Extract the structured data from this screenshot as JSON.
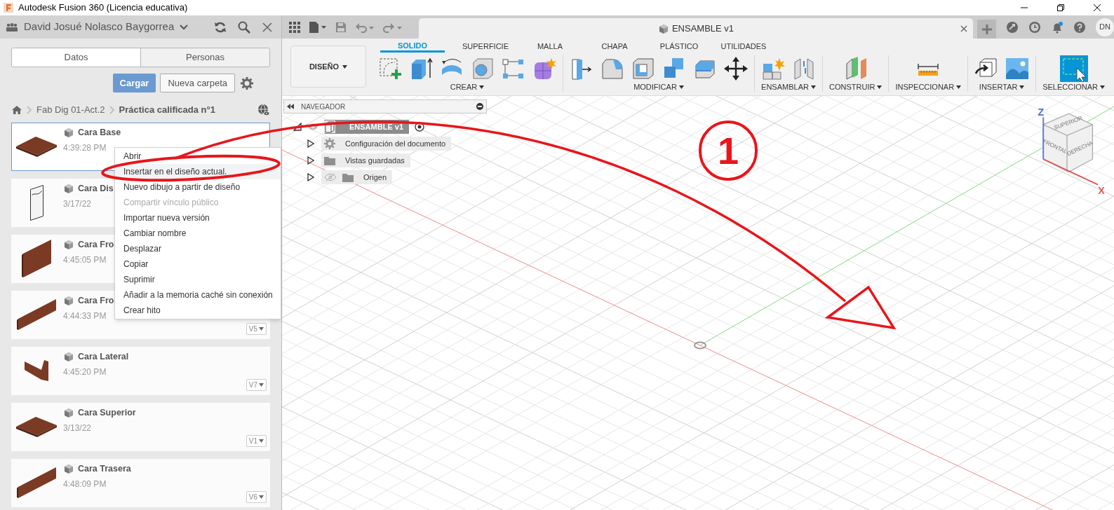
{
  "window": {
    "title": "Autodesk Fusion 360 (Licencia educativa)"
  },
  "data_panel": {
    "user": "David Josué Nolasco Baygorrea",
    "tabs": [
      {
        "label": "Datos",
        "selected": true
      },
      {
        "label": "Personas",
        "selected": false
      }
    ],
    "upload_button": "Cargar",
    "new_folder_button": "Nueva carpeta",
    "breadcrumb": [
      "Fab Dig 01-Act.2",
      "Práctica calificada n°1"
    ],
    "files": [
      {
        "name": "Cara Base",
        "date": "4:39:28 PM",
        "selected": true,
        "kind": "plate"
      },
      {
        "name": "Cara Dis",
        "date": "3/17/22",
        "selected": false,
        "kind": "sheet"
      },
      {
        "name": "Cara Fro",
        "date": "4:45:05 PM",
        "selected": false,
        "kind": "board"
      },
      {
        "name": "Cara Fro",
        "date": "4:44:33 PM",
        "version": "V5",
        "selected": false,
        "kind": "long_board"
      },
      {
        "name": "Cara Lateral",
        "date": "4:45:20 PM",
        "version": "V7",
        "selected": false,
        "kind": "side"
      },
      {
        "name": "Cara Superior",
        "date": "3/13/22",
        "version": "V1",
        "selected": false,
        "kind": "plate"
      },
      {
        "name": "Cara Trasera",
        "date": "4:48:09 PM",
        "version": "V6",
        "selected": false,
        "kind": "long_board"
      }
    ]
  },
  "context_menu": [
    {
      "label": "Abrir",
      "disabled": false,
      "highlighted": false
    },
    {
      "label": "Insertar en el diseño actual.",
      "disabled": false,
      "highlighted": true
    },
    {
      "label": "Nuevo dibujo a partir de diseño",
      "disabled": false,
      "highlighted": false
    },
    {
      "label": "Compartir vínculo público",
      "disabled": true,
      "highlighted": false
    },
    {
      "label": "Importar nueva versión",
      "disabled": false,
      "highlighted": false
    },
    {
      "label": "Cambiar nombre",
      "disabled": false,
      "highlighted": false
    },
    {
      "label": "Desplazar",
      "disabled": false,
      "highlighted": false
    },
    {
      "label": "Copiar",
      "disabled": false,
      "highlighted": false
    },
    {
      "label": "Suprimir",
      "disabled": false,
      "highlighted": false
    },
    {
      "label": "Añadir a la memoria caché sin conexión",
      "disabled": false,
      "highlighted": false
    },
    {
      "label": "Crear hito",
      "disabled": false,
      "highlighted": false
    }
  ],
  "document_tab": {
    "title": "ENSAMBLE v1"
  },
  "avatar": "DN",
  "ribbon": {
    "workspace": "DISEÑO",
    "tabs": [
      {
        "label": "SOLIDO",
        "selected": true
      },
      {
        "label": "SUPERFICIE",
        "selected": false
      },
      {
        "label": "MALLA",
        "selected": false
      },
      {
        "label": "CHAPA",
        "selected": false
      },
      {
        "label": "PLÁSTICO",
        "selected": false
      },
      {
        "label": "UTILIDADES",
        "selected": false
      }
    ],
    "groups": [
      {
        "label": "CREAR",
        "tools": [
          {
            "kind": "sketch"
          },
          {
            "kind": "extrude"
          },
          {
            "kind": "revolve"
          },
          {
            "kind": "hole"
          },
          {
            "kind": "pattern"
          },
          {
            "kind": "form"
          }
        ]
      },
      {
        "label": "MODIFICAR",
        "tools": [
          {
            "kind": "presspull"
          },
          {
            "kind": "fillet"
          },
          {
            "kind": "shell"
          },
          {
            "kind": "combine"
          },
          {
            "kind": "offset"
          },
          {
            "kind": "move"
          }
        ]
      },
      {
        "label": "ENSAMBLAR",
        "tools": [
          {
            "kind": "component"
          },
          {
            "kind": "joint"
          }
        ]
      },
      {
        "label": "CONSTRUIR",
        "tools": [
          {
            "kind": "plane"
          }
        ]
      },
      {
        "label": "INSPECCIONAR",
        "tools": [
          {
            "kind": "measure"
          }
        ]
      },
      {
        "label": "INSERTAR",
        "tools": [
          {
            "kind": "insert"
          },
          {
            "kind": "image"
          }
        ]
      },
      {
        "label": "SELECCIONAR",
        "tools": [
          {
            "kind": "select"
          }
        ]
      }
    ]
  },
  "navigator": {
    "title": "NAVEGADOR",
    "root": {
      "label": "ENSAMBLE v1",
      "expanded": true,
      "children": [
        {
          "label": "Configuración del documento",
          "kind": "settings",
          "hidden": false,
          "expanded": false
        },
        {
          "label": "Vistas guardadas",
          "kind": "folder",
          "hidden": false,
          "expanded": false
        },
        {
          "label": "Origen",
          "kind": "folder",
          "hidden": true,
          "expanded": false
        }
      ]
    }
  },
  "viewcube": {
    "faces": [
      "SUPERIOR",
      "FRONTAL",
      "DERECHA"
    ],
    "axes": [
      "Z",
      "X"
    ]
  },
  "annotation": {
    "number": "1"
  }
}
